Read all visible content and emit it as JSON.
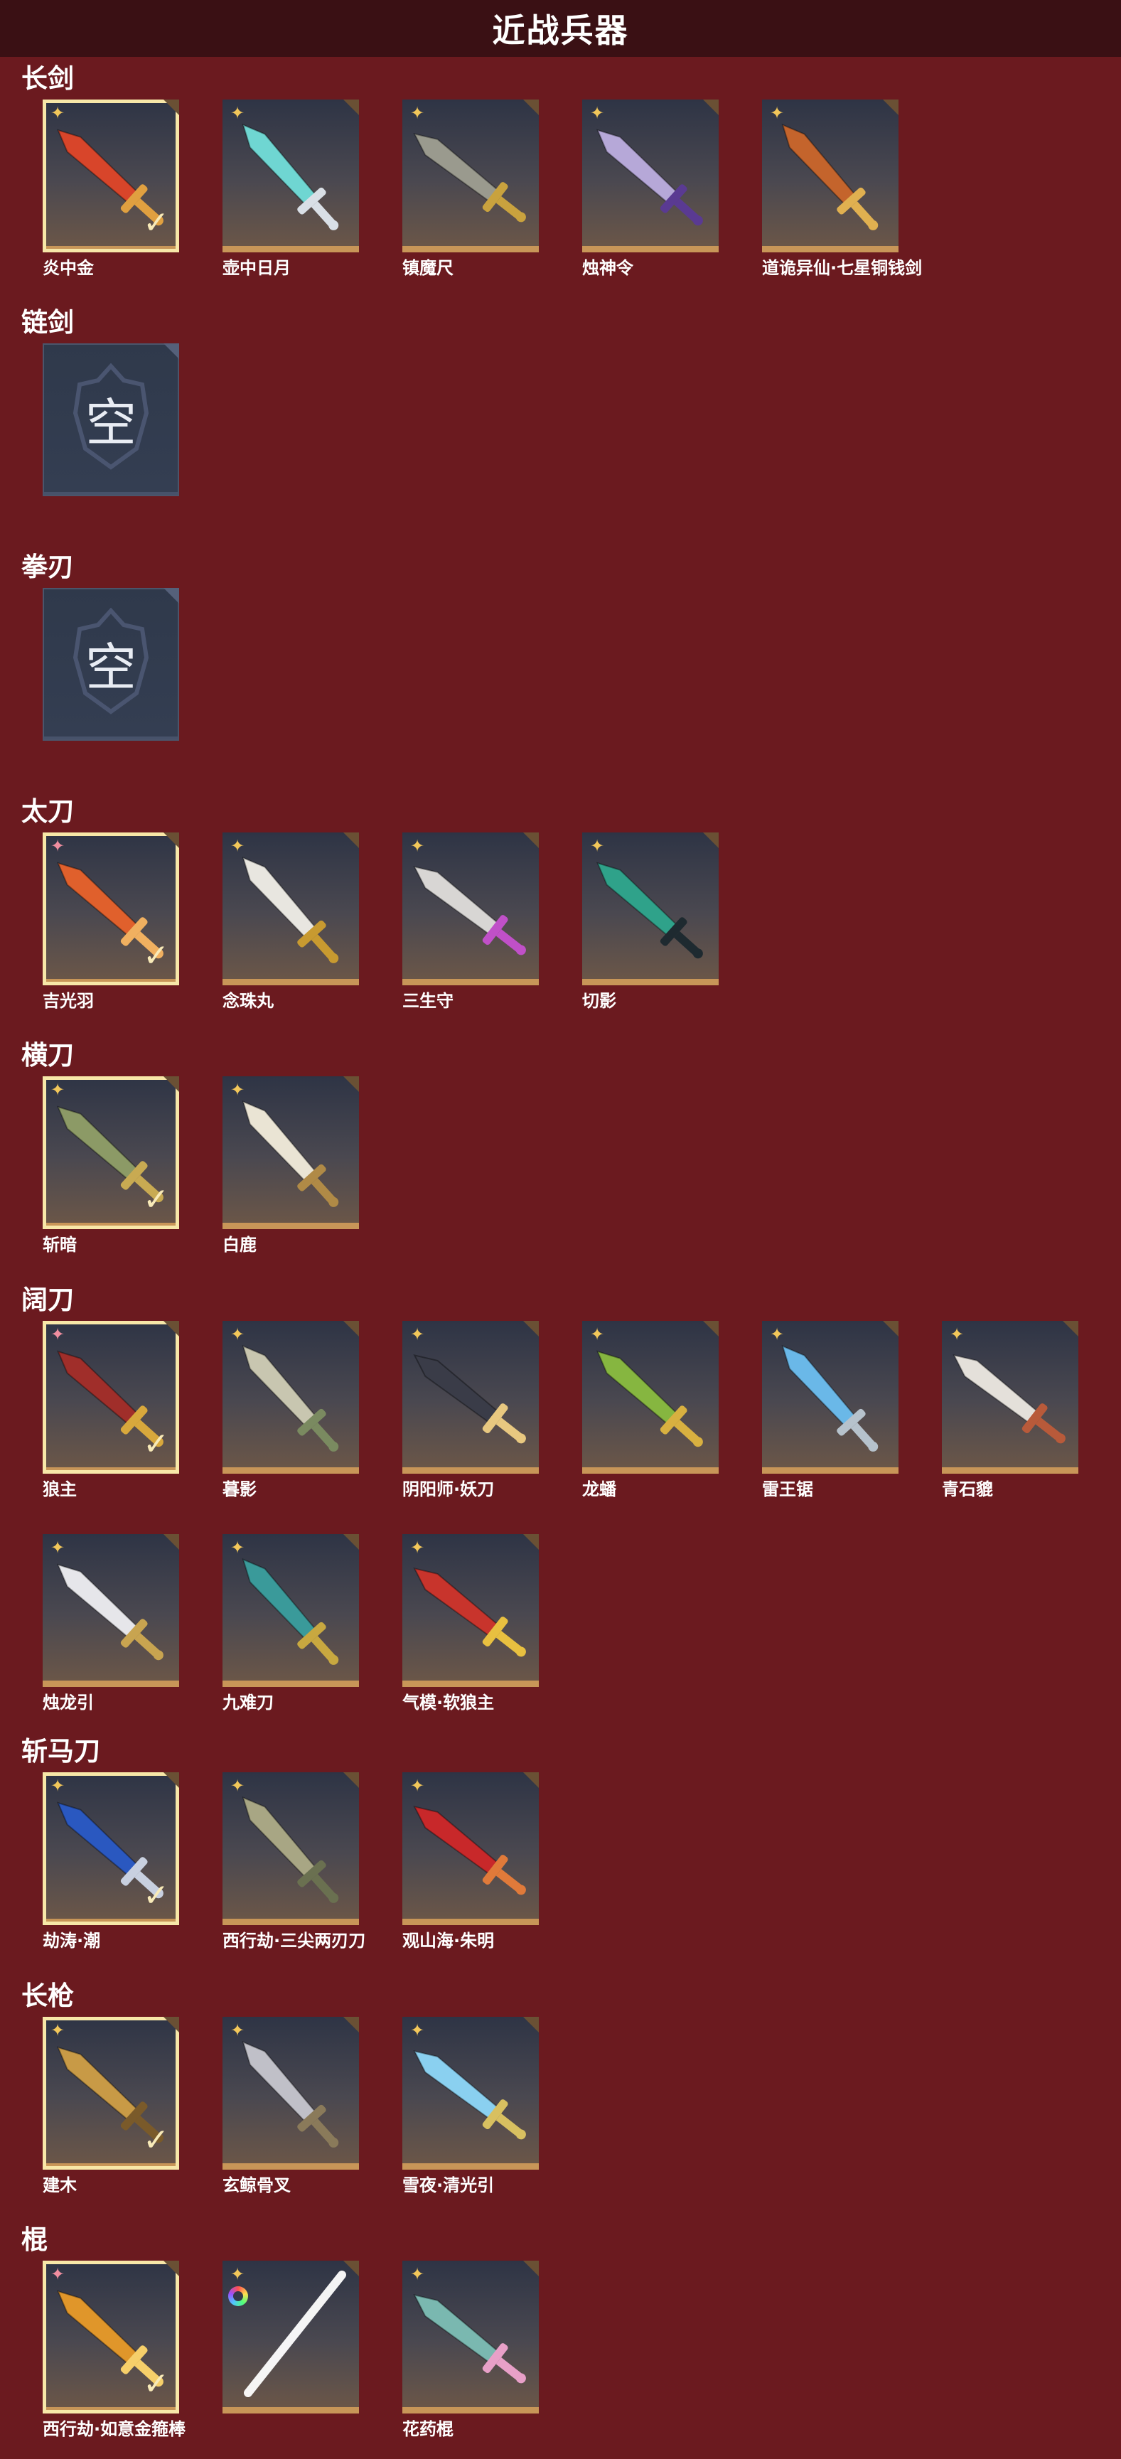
{
  "page_title": "近战兵器",
  "empty_label": "空",
  "categories": [
    {
      "name": "长剑",
      "items": [
        {
          "name": "炎中金",
          "marker": "gold",
          "equipped": true,
          "blade": "#d8452a",
          "hilt": "#e0a040"
        },
        {
          "name": "壶中日月",
          "marker": "gold",
          "equipped": false,
          "blade": "#6fd6d2",
          "hilt": "#d9dfe6"
        },
        {
          "name": "镇魔尺",
          "marker": "gold",
          "equipped": false,
          "blade": "#9a9a8e",
          "hilt": "#c9a23e"
        },
        {
          "name": "烛神令",
          "marker": "gold",
          "equipped": false,
          "blade": "#b6a8d8",
          "hilt": "#5a3a92"
        },
        {
          "name": "道诡异仙·七星铜钱剑",
          "marker": "gold",
          "equipped": false,
          "blade": "#c4642c",
          "hilt": "#e0b050"
        }
      ]
    },
    {
      "name": "链剑",
      "items": []
    },
    {
      "name": "拳刃",
      "items": []
    },
    {
      "name": "太刀",
      "items": [
        {
          "name": "吉光羽",
          "marker": "pink",
          "equipped": true,
          "blade": "#e0602c",
          "hilt": "#f0b060"
        },
        {
          "name": "念珠丸",
          "marker": "gold",
          "equipped": false,
          "blade": "#e8e6e0",
          "hilt": "#c89a30"
        },
        {
          "name": "三生守",
          "marker": "gold",
          "equipped": false,
          "blade": "#d8d6d4",
          "hilt": "#c050c8"
        },
        {
          "name": "切影",
          "marker": "gold",
          "equipped": false,
          "blade": "#2fa28a",
          "hilt": "#1e2a30"
        }
      ]
    },
    {
      "name": "横刀",
      "items": [
        {
          "name": "斩暗",
          "marker": "gold",
          "equipped": true,
          "blade": "#8c9a66",
          "hilt": "#c8aa52"
        },
        {
          "name": "白鹿",
          "marker": "gold",
          "equipped": false,
          "blade": "#eae4d4",
          "hilt": "#b08a46"
        }
      ]
    },
    {
      "name": "阔刀",
      "items": [
        {
          "name": "狼主",
          "marker": "pink",
          "equipped": true,
          "blade": "#a02e2a",
          "hilt": "#d8a83c"
        },
        {
          "name": "暮影",
          "marker": "gold",
          "equipped": false,
          "blade": "#c8c6b0",
          "hilt": "#7a8a60"
        },
        {
          "name": "阴阳师·妖刀",
          "marker": "gold",
          "equipped": false,
          "blade": "#3a3c48",
          "hilt": "#e8c880"
        },
        {
          "name": "龙蟠",
          "marker": "gold",
          "equipped": false,
          "blade": "#86b640",
          "hilt": "#d8b040"
        },
        {
          "name": "雷王锯",
          "marker": "gold",
          "equipped": false,
          "blade": "#6ab8e8",
          "hilt": "#b6c2cc"
        },
        {
          "name": "青石貔",
          "marker": "gold",
          "equipped": false,
          "blade": "#e4e0da",
          "hilt": "#b85a3a"
        },
        {
          "name": "烛龙引",
          "marker": "gold",
          "equipped": false,
          "blade": "#e6e6ea",
          "hilt": "#c8a450"
        },
        {
          "name": "九难刀",
          "marker": "gold",
          "equipped": false,
          "blade": "#3a9a9a",
          "hilt": "#c8a840"
        },
        {
          "name": "气模·软狼主",
          "marker": "gold",
          "equipped": false,
          "blade": "#c8342c",
          "hilt": "#e8c040"
        }
      ]
    },
    {
      "name": "斩马刀",
      "items": [
        {
          "name": "劫涛·潮",
          "marker": "gold",
          "equipped": true,
          "blade": "#2a58c0",
          "hilt": "#c8d0e0"
        },
        {
          "name": "西行劫·三尖两刃刀",
          "marker": "gold",
          "equipped": false,
          "blade": "#a8a684",
          "hilt": "#6a7050"
        },
        {
          "name": "观山海·朱明",
          "marker": "gold",
          "equipped": false,
          "blade": "#c8282a",
          "hilt": "#e07a3a"
        }
      ]
    },
    {
      "name": "长枪",
      "items": [
        {
          "name": "建木",
          "marker": "gold",
          "equipped": true,
          "blade": "#c89a46",
          "hilt": "#7a5a2a"
        },
        {
          "name": "玄鲸骨叉",
          "marker": "gold",
          "equipped": false,
          "blade": "#c0c0c8",
          "hilt": "#8a7a5a"
        },
        {
          "name": "雪夜·清光引",
          "marker": "gold",
          "equipped": false,
          "blade": "#8ad0f0",
          "hilt": "#d8c060"
        }
      ]
    },
    {
      "name": "棍",
      "items": [
        {
          "name": "西行劫·如意金箍棒",
          "marker": "pink",
          "equipped": true,
          "blade": "#e0962a",
          "hilt": "#f6cf6a"
        },
        {
          "name": "",
          "marker": "gold",
          "equipped": false,
          "blade": "#f4f4f4",
          "hilt": "#ffffff",
          "glow": true
        },
        {
          "name": "花药棍",
          "marker": "gold",
          "equipped": false,
          "blade": "#7ab8b0",
          "hilt": "#e8a0c8"
        }
      ]
    }
  ],
  "colors": {
    "background": "#6b1a1f",
    "header": "#3a1014",
    "frame_gold": "#c89658",
    "equipped_outline": "#f7e7a8",
    "star_gold": "#f2c75a",
    "star_pink": "#f08ea0"
  },
  "icons": {
    "marker_gold": "gold-star-icon",
    "marker_pink": "pink-star-icon",
    "equipped": "checkmark-icon",
    "empty_slot": "helmet-emblem-icon"
  }
}
